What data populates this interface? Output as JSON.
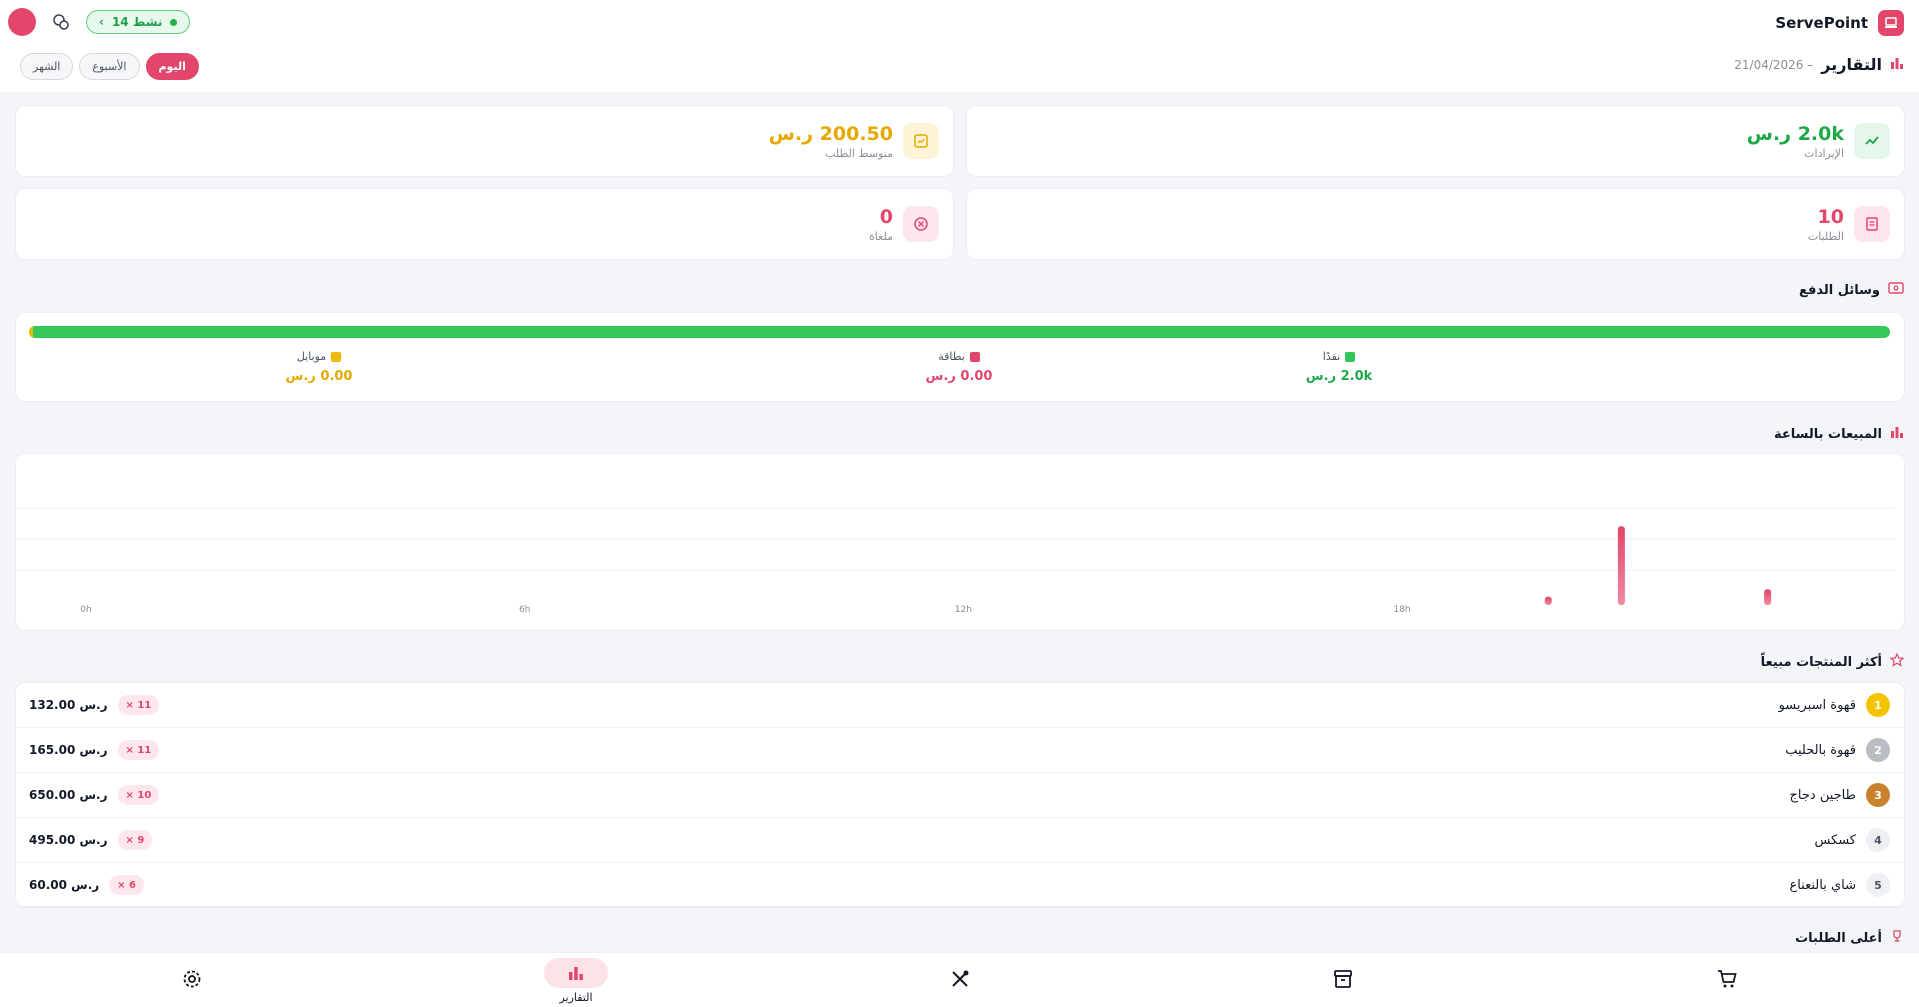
{
  "app": {
    "name": "ServePoint"
  },
  "header": {
    "active_count_label": "14 نشط",
    "page_title": "التقارير",
    "date": "21/04/2026",
    "date_sep": "–"
  },
  "period_tabs": [
    {
      "label": "اليوم",
      "active": true
    },
    {
      "label": "الأسبوع",
      "active": false
    },
    {
      "label": "الشهر",
      "active": false
    }
  ],
  "stats": {
    "revenue": {
      "value": "2.0k ر.س",
      "label": "الإيرادات",
      "color": "#1fa84a"
    },
    "avg_order": {
      "value": "200.50 ر.س",
      "label": "متوسط الطلب",
      "color": "#e6a800"
    },
    "orders": {
      "value": "10",
      "label": "الطلبات",
      "color": "#e2466a"
    },
    "cancelled": {
      "value": "0",
      "label": "ملغاة",
      "color": "#e2466a"
    }
  },
  "payments": {
    "title": "وسائل الدفع",
    "cash": {
      "label": "نقدًا",
      "value": "2.0k ر.س",
      "color": "#34c759",
      "share": 99.7
    },
    "card": {
      "label": "بطاقة",
      "value": "0.00 ر.س",
      "color": "#e2466a",
      "share": 0
    },
    "mobile": {
      "label": "موبايل",
      "value": "0.00 ر.س",
      "color": "#f0b800",
      "share": 0.3
    }
  },
  "hourly_sales": {
    "title": "المبيعات بالساعة"
  },
  "chart_data": {
    "type": "bar",
    "title": "المبيعات بالساعة",
    "x_ticks": [
      "0h",
      "6h",
      "12h",
      "18h"
    ],
    "xlim": [
      0,
      24
    ],
    "points": [
      {
        "hour": 20,
        "value": 8
      },
      {
        "hour": 21,
        "value": 75
      },
      {
        "hour": 23,
        "value": 15
      }
    ],
    "ylim": [
      0,
      100
    ],
    "grid": true,
    "color": "#e2466a"
  },
  "top_products": {
    "title": "أكثر المنتجات مبيعاً",
    "items": [
      {
        "rank": "1",
        "name": "قهوة اسبريسو",
        "qty": "× 11",
        "price": "132.00 ر.س",
        "rank_bg": "#f5c400",
        "rank_color": "#ffffff"
      },
      {
        "rank": "2",
        "name": "قهوة بالحليب",
        "qty": "× 11",
        "price": "165.00 ر.س",
        "rank_bg": "#b9bcc3",
        "rank_color": "#ffffff"
      },
      {
        "rank": "3",
        "name": "طاجين دجاج",
        "qty": "× 10",
        "price": "650.00 ر.س",
        "rank_bg": "#c9812e",
        "rank_color": "#ffffff"
      },
      {
        "rank": "4",
        "name": "كسكس",
        "qty": "× 9",
        "price": "495.00 ر.س",
        "rank_bg": "#eef0f4",
        "rank_color": "#4b5563"
      },
      {
        "rank": "5",
        "name": "شاي بالنعناع",
        "qty": "× 6",
        "price": "60.00 ر.س",
        "rank_bg": "#eef0f4",
        "rank_color": "#4b5563"
      }
    ]
  },
  "top_orders": {
    "title": "أعلى الطلبات"
  },
  "nav": {
    "reports_label": "التقارير"
  },
  "colors": {
    "accent": "#e2466a",
    "green": "#34c759",
    "yellow": "#f0b800"
  }
}
